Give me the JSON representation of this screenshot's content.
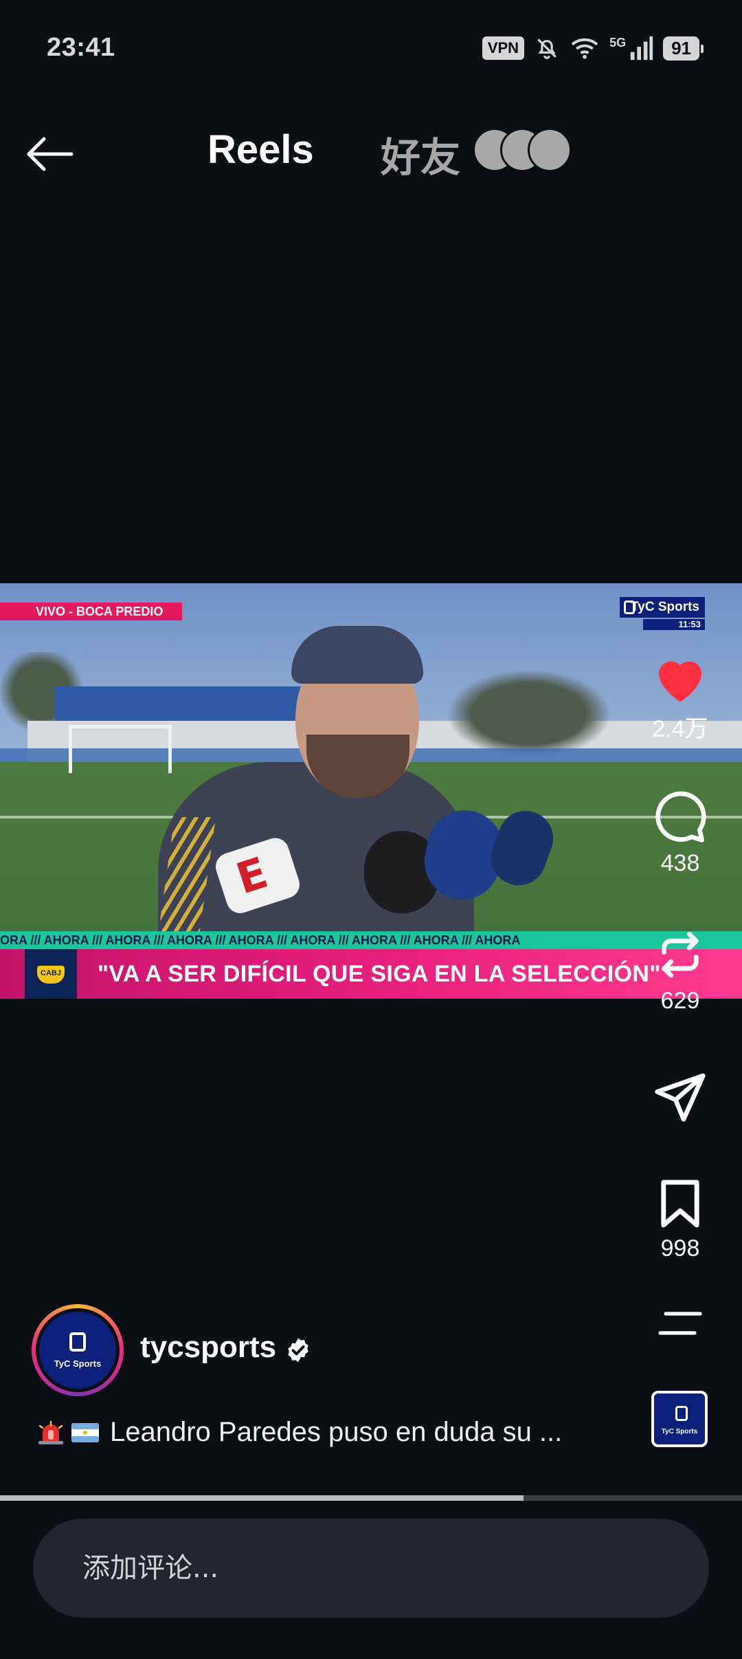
{
  "status_bar": {
    "time": "23:41",
    "vpn": "VPN",
    "network": "5G",
    "battery": "91",
    "icons": [
      "vpn-badge",
      "mute-icon",
      "wifi-icon",
      "signal-icon",
      "battery-icon"
    ]
  },
  "top_nav": {
    "back_icon": "arrow-left-icon",
    "title": "Reels",
    "friends_label": "好友",
    "friend_avatar_count": 3
  },
  "video": {
    "overlay_live_label": "VIVO - BOCA PREDIO",
    "channel_logo": "TyC Sports",
    "channel_clock": "11:53",
    "ticker_word": "AHORA",
    "ticker_text": "ORA  ///  AHORA  ///  AHORA  ///  AHORA  ///  AHORA  ///  AHORA  ///  AHORA  ///  AHORA  ///  AHORA",
    "headline": "\"VA A SER DIFÍCIL QUE SIGA EN LA SELECCIÓN\"",
    "crest_text": "CABJ"
  },
  "actions": {
    "like": {
      "icon": "heart-icon",
      "count": "2.4万",
      "active": true,
      "color": "#ff3040"
    },
    "comment": {
      "icon": "comment-icon",
      "count": "438"
    },
    "repost": {
      "icon": "repost-icon",
      "count": "629"
    },
    "send": {
      "icon": "send-icon"
    },
    "save": {
      "icon": "bookmark-icon",
      "count": "998"
    },
    "more": {
      "icon": "more-icon"
    },
    "audio": {
      "icon": "audio-thumbnail",
      "label": "TyC Sports"
    }
  },
  "author": {
    "name": "tycsports",
    "verified": true,
    "avatar_label": "TyC Sports"
  },
  "caption": {
    "emojis": [
      "siren-emoji",
      "argentina-flag-emoji"
    ],
    "text": "Leandro Paredes puso en duda su ..."
  },
  "progress": {
    "fraction": 0.706
  },
  "comment_input": {
    "placeholder": "添加评论..."
  }
}
